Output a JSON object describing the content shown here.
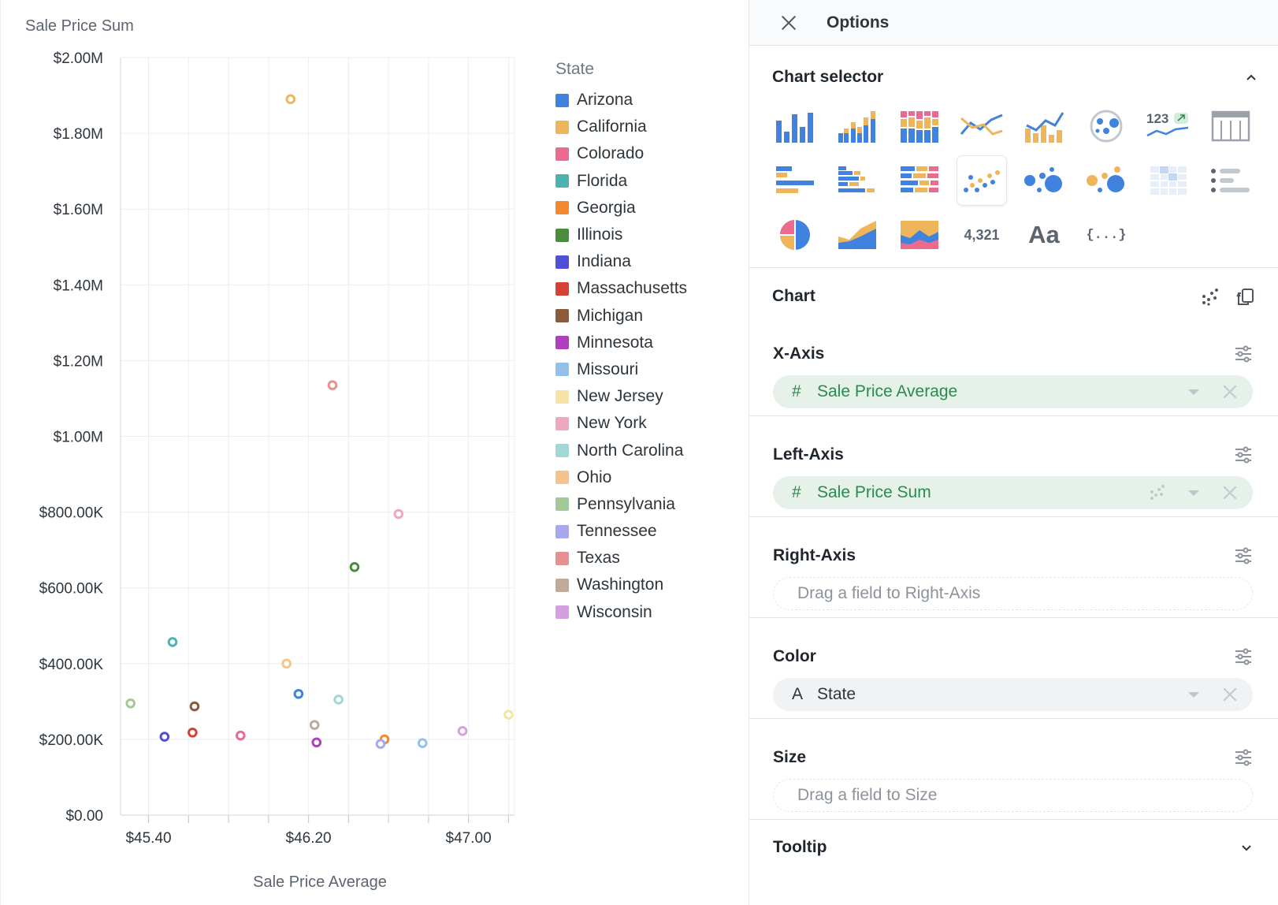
{
  "chart_data": {
    "type": "scatter",
    "title": "Sale Price Sum",
    "xlabel": "Sale Price Average",
    "ylabel": "Sale Price Sum",
    "xlim": [
      45.26,
      47.23
    ],
    "ylim": [
      0,
      2000000
    ],
    "x_ticks": [
      {
        "value": 45.4,
        "label": "$45.40"
      },
      {
        "value": 46.2,
        "label": "$46.20"
      },
      {
        "value": 47.0,
        "label": "$47.00"
      }
    ],
    "x_minor_ticks": [
      45.6,
      45.8,
      46.0,
      46.4,
      46.6,
      46.8,
      47.2
    ],
    "y_ticks": [
      {
        "value": 0,
        "label": "$0.00"
      },
      {
        "value": 200000,
        "label": "$200.00K"
      },
      {
        "value": 400000,
        "label": "$400.00K"
      },
      {
        "value": 600000,
        "label": "$600.00K"
      },
      {
        "value": 800000,
        "label": "$800.00K"
      },
      {
        "value": 1000000,
        "label": "$1.00M"
      },
      {
        "value": 1200000,
        "label": "$1.20M"
      },
      {
        "value": 1400000,
        "label": "$1.40M"
      },
      {
        "value": 1600000,
        "label": "$1.60M"
      },
      {
        "value": 1800000,
        "label": "$1.80M"
      },
      {
        "value": 2000000,
        "label": "$2.00M"
      }
    ],
    "grid": true,
    "legend": {
      "title": "State",
      "position": "right"
    },
    "series": [
      {
        "name": "Arizona",
        "color": "#3f83de",
        "x": 46.15,
        "y": 320000
      },
      {
        "name": "California",
        "color": "#efb55b",
        "x": 46.11,
        "y": 1890000
      },
      {
        "name": "Colorado",
        "color": "#eb6a8e",
        "x": 45.86,
        "y": 210000
      },
      {
        "name": "Florida",
        "color": "#4bb3b3",
        "x": 45.52,
        "y": 457000
      },
      {
        "name": "Georgia",
        "color": "#f38830",
        "x": 46.58,
        "y": 200000
      },
      {
        "name": "Illinois",
        "color": "#4a8e3c",
        "x": 46.43,
        "y": 655000
      },
      {
        "name": "Indiana",
        "color": "#4f4fd8",
        "x": 45.48,
        "y": 207000
      },
      {
        "name": "Massachusetts",
        "color": "#d64135",
        "x": 45.62,
        "y": 218000
      },
      {
        "name": "Michigan",
        "color": "#8b5a3a",
        "x": 45.63,
        "y": 287000
      },
      {
        "name": "Minnesota",
        "color": "#b03fbf",
        "x": 46.24,
        "y": 192000
      },
      {
        "name": "Missouri",
        "color": "#93c0ec",
        "x": 46.77,
        "y": 190000
      },
      {
        "name": "New Jersey",
        "color": "#f6e4a4",
        "x": 47.2,
        "y": 265000
      },
      {
        "name": "New York",
        "color": "#efa6c1",
        "x": 46.65,
        "y": 795000
      },
      {
        "name": "North Carolina",
        "color": "#a0d8d6",
        "x": 46.35,
        "y": 305000
      },
      {
        "name": "Ohio",
        "color": "#f5c38c",
        "x": 46.09,
        "y": 400000
      },
      {
        "name": "Pennsylvania",
        "color": "#a2c996",
        "x": 45.31,
        "y": 295000
      },
      {
        "name": "Tennessee",
        "color": "#a6a9ec",
        "x": 46.56,
        "y": 188000
      },
      {
        "name": "Texas",
        "color": "#e69090",
        "x": 46.32,
        "y": 1135000
      },
      {
        "name": "Washington",
        "color": "#c2aa99",
        "x": 46.23,
        "y": 238000
      },
      {
        "name": "Wisconsin",
        "color": "#d5a0df",
        "x": 46.97,
        "y": 222000
      }
    ]
  },
  "panel": {
    "title": "Options",
    "chart_selector": {
      "title": "Chart selector",
      "kpi_label": "123",
      "number_label": "4,321",
      "text_label": "Aa",
      "json_label": "{...}"
    },
    "chart_section_title": "Chart",
    "x_axis": {
      "title": "X-Axis",
      "field_type": "#",
      "field": "Sale Price Average"
    },
    "left_axis": {
      "title": "Left-Axis",
      "field_type": "#",
      "field": "Sale Price Sum"
    },
    "right_axis": {
      "title": "Right-Axis",
      "placeholder": "Drag a field to Right-Axis"
    },
    "color": {
      "title": "Color",
      "field_type": "A",
      "field": "State"
    },
    "size": {
      "title": "Size",
      "placeholder": "Drag a field to Size"
    },
    "tooltip": {
      "title": "Tooltip"
    }
  },
  "colors": {
    "accent_blue": "#3f83de",
    "accent_orange": "#efb55b",
    "pill_green_bg": "#e6f1ea",
    "pill_green_text": "#2c8a4f"
  }
}
